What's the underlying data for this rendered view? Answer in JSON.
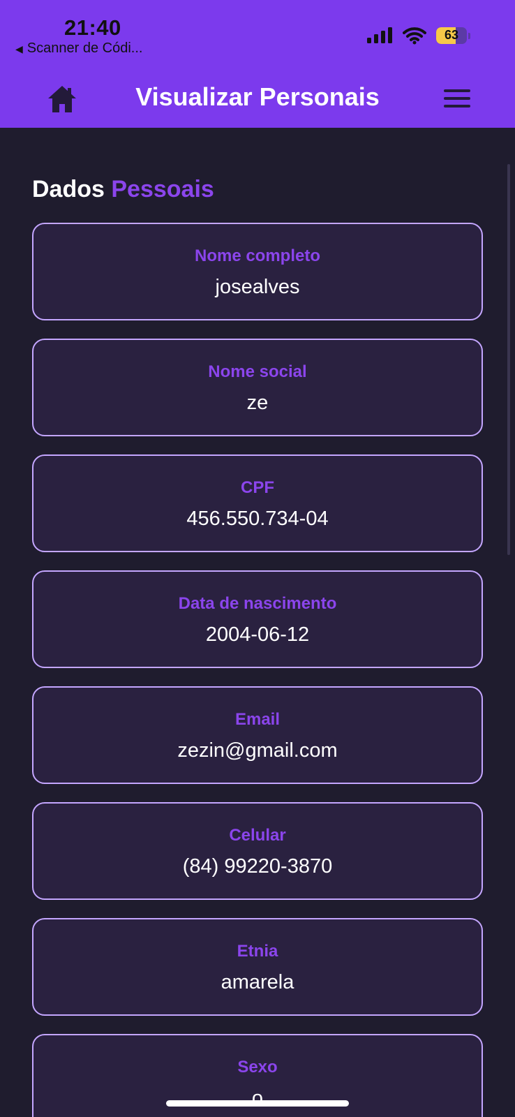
{
  "status_bar": {
    "time": "21:40",
    "back_label": "Scanner de Códi...",
    "battery_level": 63,
    "battery_text": "63"
  },
  "header": {
    "title": "Visualizar Personais",
    "home_icon": "home-icon",
    "menu_icon": "hamburger-menu-icon"
  },
  "section": {
    "title_part1": "Dados",
    "title_part2": "Pessoais"
  },
  "fields": [
    {
      "label": "Nome completo",
      "value": "josealves"
    },
    {
      "label": "Nome social",
      "value": "ze"
    },
    {
      "label": "CPF",
      "value": "456.550.734-04"
    },
    {
      "label": "Data de nascimento",
      "value": "2004-06-12"
    },
    {
      "label": "Email",
      "value": "zezin@gmail.com"
    },
    {
      "label": "Celular",
      "value": "(84) 99220-3870"
    },
    {
      "label": "Etnia",
      "value": "amarela"
    },
    {
      "label": "Sexo",
      "value": "o"
    }
  ],
  "colors": {
    "header_bg": "#7c3aed",
    "page_bg": "#1f1c2e",
    "card_bg": "#2a2140",
    "card_border": "#c4a6ff",
    "accent": "#8b45ec"
  }
}
